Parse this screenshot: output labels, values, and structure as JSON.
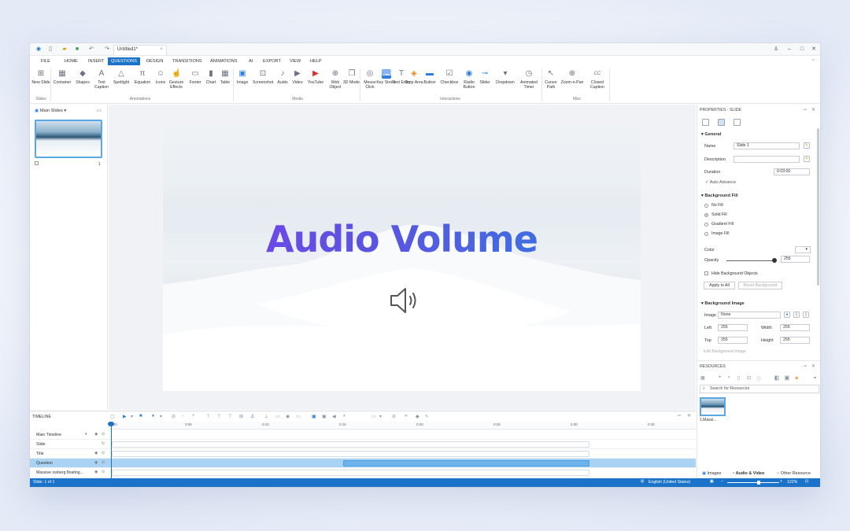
{
  "titlebar": {
    "doc_title": "Untitled1*",
    "close_tab": "×",
    "icons": [
      "app-logo-icon",
      "new-file-icon",
      "open-folder-icon",
      "save-icon",
      "undo-icon",
      "redo-icon"
    ],
    "window_controls": {
      "user": "♙",
      "minimize": "–",
      "maximize": "□",
      "close": "✕"
    }
  },
  "menu": {
    "items": [
      "FILE",
      "HOME",
      "INSERT",
      "QUESTIONS",
      "DESIGN",
      "TRANSITIONS",
      "ANIMATIONS",
      "AI",
      "EXPORT",
      "VIEW",
      "HELP"
    ],
    "active": "QUESTIONS",
    "collapse": "^"
  },
  "ribbon": {
    "groups": {
      "slides": "Slides",
      "annotations": "Annotations",
      "media": "Media",
      "interactions": "Interactions",
      "misc": "Misc"
    },
    "buttons": [
      {
        "label": "New Slide",
        "glyph": "⊞"
      },
      {
        "label": "Container",
        "glyph": "▦"
      },
      {
        "label": "Shapes",
        "glyph": "◆"
      },
      {
        "label": "Text Caption",
        "glyph": "A"
      },
      {
        "label": "Spotlight",
        "glyph": "△"
      },
      {
        "label": "Equation",
        "glyph": "π"
      },
      {
        "label": "Icons",
        "glyph": "☺"
      },
      {
        "label": "Gesture Effects",
        "glyph": "☝"
      },
      {
        "label": "Footer",
        "glyph": "▭"
      },
      {
        "label": "Chart",
        "glyph": "▮"
      },
      {
        "label": "Table",
        "glyph": "▦"
      },
      {
        "label": "Image",
        "glyph": "▣"
      },
      {
        "label": "Screenshot",
        "glyph": "⊡"
      },
      {
        "label": "Audio",
        "glyph": "♪"
      },
      {
        "label": "Video",
        "glyph": "▶"
      },
      {
        "label": "YouTube",
        "glyph": "▶"
      },
      {
        "label": "Web Object",
        "glyph": "⊕"
      },
      {
        "label": "3D Model",
        "glyph": "❒"
      },
      {
        "label": "Mouse Click",
        "glyph": "◎"
      },
      {
        "label": "Key Stroke",
        "glyph": "⌨"
      },
      {
        "label": "Text Entry",
        "glyph": "T"
      },
      {
        "label": "Drop Area",
        "glyph": "◈"
      },
      {
        "label": "Button",
        "glyph": "▬"
      },
      {
        "label": "Checkbox",
        "glyph": "☑"
      },
      {
        "label": "Radio Button",
        "glyph": "◉"
      },
      {
        "label": "Slider",
        "glyph": "⊸"
      },
      {
        "label": "Dropdown",
        "glyph": "▾"
      },
      {
        "label": "Animated Timer",
        "glyph": "◷"
      },
      {
        "label": "Cursor Path",
        "glyph": "↖"
      },
      {
        "label": "Zoom-n-Pan",
        "glyph": "⊕"
      },
      {
        "label": "Closed Caption",
        "glyph": "CC"
      }
    ]
  },
  "slides_panel": {
    "header": "Main Slides",
    "slide_number": "1"
  },
  "slide": {
    "title": "Audio Volume",
    "title_gradient": [
      "#7a3fe8",
      "#2f7de0"
    ]
  },
  "properties": {
    "header": "PROPERTIES - SLIDE",
    "general": {
      "section": "General",
      "name_label": "Name",
      "name_value": "Slide 1",
      "description_label": "Description",
      "description_value": "",
      "duration_label": "Duration",
      "duration_value": "0:03:00",
      "auto_advance": "Auto Advance"
    },
    "background_fill": {
      "section": "Background Fill",
      "options": [
        "No Fill",
        "Solid Fill",
        "Gradient Fill",
        "Image Fill"
      ],
      "selected": "Solid Fill",
      "color_label": "Color",
      "color_value": "#ffffff",
      "opacity_label": "Opacity",
      "opacity_value": "255",
      "hide_bg_objects": "Hide Background Objects",
      "apply_all": "Apply to All",
      "reset_bg": "Reset Background"
    },
    "background_image": {
      "section": "Background Image",
      "image_label": "Image",
      "image_value": "None",
      "left_label": "Left",
      "left_value": "255",
      "width_label": "Width",
      "width_value": "255",
      "top_label": "Top",
      "top_value": "255",
      "height_label": "Height",
      "height_value": "255",
      "edit_button": "Edit Background Image"
    }
  },
  "resources": {
    "header": "RESOURCES",
    "search_placeholder": "Search for Resources",
    "item_label": "1.Massi...",
    "tabs": [
      "Images",
      "Audio & Video",
      "Other Resource"
    ],
    "active_tab": "Audio & Video"
  },
  "timeline": {
    "header": "TIMELINE",
    "ticks": [
      "0:00",
      "0:05",
      "0:10",
      "0:15",
      "0:20",
      "0:25",
      "0:30",
      "0:35"
    ],
    "rows": [
      {
        "name": "Main Timeline"
      },
      {
        "name": "Slide"
      },
      {
        "name": "Title"
      },
      {
        "name": "Question"
      },
      {
        "name": "Massive iceberg floating..."
      }
    ],
    "selected_row": "Question"
  },
  "statusbar": {
    "slide_info": "Slide: 1 of 1",
    "language": "English (United States)",
    "zoom": "122%",
    "zoom_minus": "−",
    "zoom_plus": "+"
  }
}
